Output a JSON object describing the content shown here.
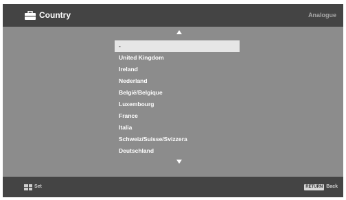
{
  "header": {
    "title": "Country",
    "title_icon": "toolbox-icon",
    "mode": "Analogue"
  },
  "list": {
    "scroll_up_icon": "triangle-up-icon",
    "scroll_down_icon": "triangle-down-icon",
    "selected_index": 0,
    "items": [
      {
        "label": "-"
      },
      {
        "label": "United Kingdom"
      },
      {
        "label": "Ireland"
      },
      {
        "label": "Nederland"
      },
      {
        "label": "België/Belgique"
      },
      {
        "label": "Luxembourg"
      },
      {
        "label": "France"
      },
      {
        "label": "Italia"
      },
      {
        "label": "Schweiz/Suisse/Svizzera"
      },
      {
        "label": "Deutschland"
      }
    ]
  },
  "footer": {
    "set_icon": "dpad-icon",
    "set_label": "Set",
    "return_key_label": "RETURN",
    "back_label": "Back"
  },
  "colors": {
    "background": "#8c8c8c",
    "bar": "#444444",
    "selection": "#e6e6e6"
  }
}
